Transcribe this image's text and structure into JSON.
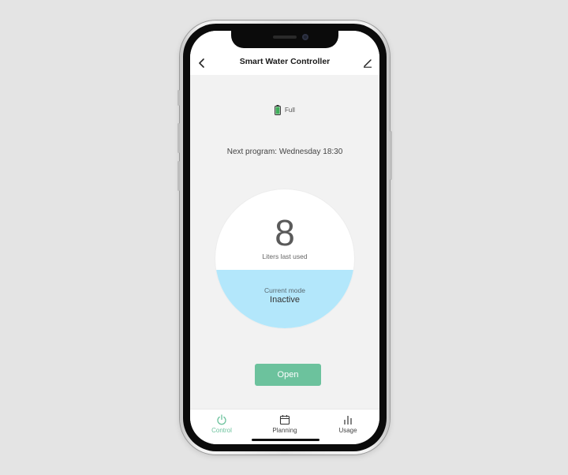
{
  "header": {
    "title": "Smart Water Controller"
  },
  "battery": {
    "label": "Full",
    "level": 1.0,
    "color": "#3fae5a"
  },
  "next_program": "Next program: Wednesday 18:30",
  "gauge": {
    "liters_value": "8",
    "liters_label": "Liters last used",
    "mode_label": "Current mode",
    "mode_value": "Inactive",
    "fill_fraction": 0.42,
    "fill_color": "#b3e7fb"
  },
  "open_button": {
    "label": "Open",
    "color": "#6cc29d"
  },
  "bottom_nav": {
    "items": [
      {
        "label": "Control",
        "icon": "power-icon",
        "active": true
      },
      {
        "label": "Planning",
        "icon": "calendar-icon",
        "active": false
      },
      {
        "label": "Usage",
        "icon": "bar-chart-icon",
        "active": false
      }
    ]
  },
  "icons": {
    "back": "chevron-left-icon",
    "edit": "pencil-icon"
  }
}
